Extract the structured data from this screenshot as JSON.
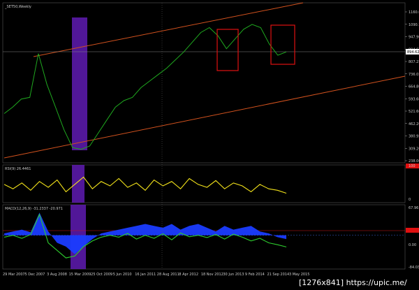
{
  "window": {
    "title": "_SET50,Weekly"
  },
  "watermark": "[1276x841] https://upic.me/",
  "colors": {
    "price_line": "#1fa81f",
    "trend_channel": "#d2521e",
    "highlight_box": "#e01010",
    "purple_band": "#5a1aa8",
    "rsi_line": "#f2e21a",
    "macd_hist": "#1a3cff",
    "macd_signal": "#d01818",
    "macd_line": "#2ecc2e",
    "axis_box_price": "#ffffff",
    "axis_box_rsi": "#e01010"
  },
  "chart_data": [
    {
      "type": "line",
      "name": "price",
      "title": "_SET50,Weekly",
      "yticks": [
        "1160.00",
        "1090.75",
        "947.90",
        "894.62",
        "807.25",
        "736.05",
        "664.80",
        "593.60",
        "521.60",
        "462.20",
        "380.95",
        "309.20",
        "238.00"
      ],
      "current_value": "894.62",
      "ylim": [
        238,
        1160
      ],
      "series": [
        {
          "name": "price",
          "values": [
            520,
            560,
            610,
            620,
            890,
            700,
            560,
            420,
            310,
            300,
            320,
            400,
            480,
            560,
            600,
            620,
            680,
            720,
            760,
            800,
            850,
            900,
            960,
            1020,
            1050,
            1000,
            920,
            980,
            1040,
            1070,
            1050,
            950,
            880,
            900
          ]
        }
      ],
      "annotations": [
        "purple-band",
        "box-1",
        "box-2"
      ]
    },
    {
      "type": "line",
      "name": "rsi",
      "title": "RSI(9) 26.4461",
      "yticks": [
        "100",
        "0"
      ],
      "ylim": [
        0,
        100
      ],
      "series": [
        {
          "name": "RSI",
          "values": [
            55,
            40,
            60,
            35,
            65,
            45,
            70,
            30,
            55,
            80,
            40,
            65,
            50,
            75,
            45,
            60,
            35,
            70,
            50,
            65,
            40,
            75,
            55,
            45,
            68,
            40,
            60,
            50,
            30,
            55,
            40,
            35,
            25
          ]
        }
      ]
    },
    {
      "type": "line",
      "name": "macd",
      "title": "MACD(12,26,9) -31.2337 -20.971",
      "yticks": [
        "67.96",
        "0.00",
        "-84.03"
      ],
      "ylim": [
        -84,
        68
      ],
      "series": [
        {
          "name": "histogram",
          "values": [
            5,
            10,
            15,
            8,
            60,
            10,
            -20,
            -30,
            -50,
            -30,
            -10,
            5,
            10,
            15,
            20,
            25,
            30,
            25,
            20,
            30,
            15,
            25,
            30,
            20,
            10,
            25,
            15,
            20,
            25,
            10,
            5,
            -5,
            -10
          ]
        },
        {
          "name": "macd",
          "values": [
            -5,
            0,
            -8,
            2,
            55,
            -20,
            -40,
            -60,
            -55,
            -30,
            -15,
            -5,
            0,
            -5,
            5,
            -10,
            0,
            -8,
            4,
            -12,
            6,
            -4,
            0,
            -6,
            2,
            -10,
            3,
            -5,
            -15,
            -8,
            -20,
            -25,
            -31
          ]
        }
      ]
    }
  ],
  "x_axis": {
    "labels": [
      "29 Mar 2007",
      "5 Dec 2007",
      "3 Aug 2008",
      "15 Mar 2009",
      "25 Oct 2009",
      "5 Jun 2010",
      "16 Jan 2011",
      "28 Aug 2011",
      "8 Apr 2012",
      "18 Nov 2012",
      "30 Jun 2013",
      "9 Feb 2014",
      "21 Sep 2014",
      "3 May 2015"
    ]
  }
}
